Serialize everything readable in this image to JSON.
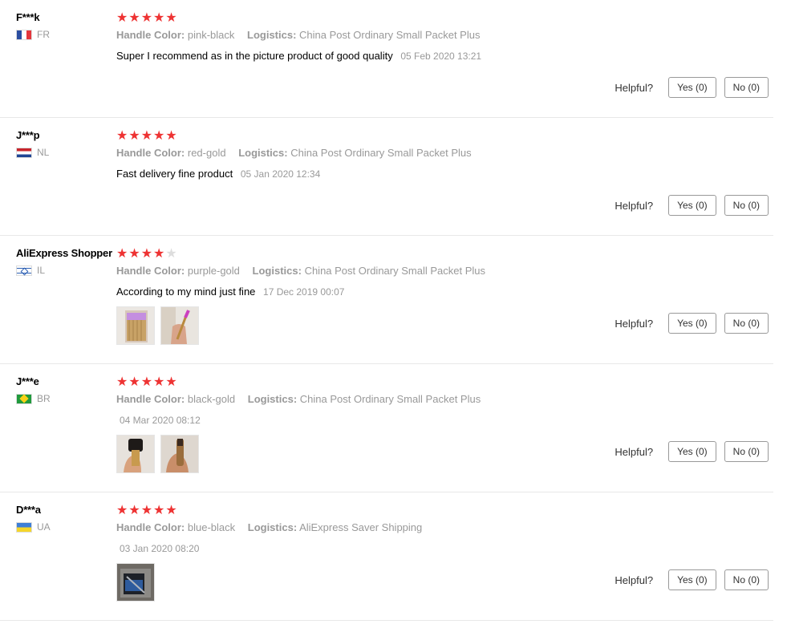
{
  "helpful_label": "Helpful?",
  "reviews": [
    {
      "user": "F***k",
      "country": "FR",
      "rating": 5,
      "handle_color_label": "Handle Color:",
      "handle_color": "pink-black",
      "logistics_label": "Logistics:",
      "logistics": "China Post Ordinary Small Packet Plus",
      "text": "Super I recommend as in the picture product of good quality",
      "date": "05 Feb 2020 13:21",
      "yes": "Yes (0)",
      "no": "No (0)"
    },
    {
      "user": "J***p",
      "country": "NL",
      "rating": 5,
      "handle_color_label": "Handle Color:",
      "handle_color": "red-gold",
      "logistics_label": "Logistics:",
      "logistics": "China Post Ordinary Small Packet Plus",
      "text": "Fast delivery fine product",
      "date": "05 Jan 2020 12:34",
      "yes": "Yes (0)",
      "no": "No (0)"
    },
    {
      "user": "AliExpress Shopper",
      "country": "IL",
      "rating": 4,
      "handle_color_label": "Handle Color:",
      "handle_color": "purple-gold",
      "logistics_label": "Logistics:",
      "logistics": "China Post Ordinary Small Packet Plus",
      "text": "According to my mind just fine",
      "date": "17 Dec 2019 00:07",
      "yes": "Yes (0)",
      "no": "No (0)",
      "photos": 2
    },
    {
      "user": "J***e",
      "country": "BR",
      "rating": 5,
      "handle_color_label": "Handle Color:",
      "handle_color": "black-gold",
      "logistics_label": "Logistics:",
      "logistics": "China Post Ordinary Small Packet Plus",
      "text": "",
      "date": "04 Mar 2020 08:12",
      "yes": "Yes (0)",
      "no": "No (0)",
      "photos": 2
    },
    {
      "user": "D***a",
      "country": "UA",
      "rating": 5,
      "handle_color_label": "Handle Color:",
      "handle_color": "blue-black",
      "logistics_label": "Logistics:",
      "logistics": "AliExpress Saver Shipping",
      "text": "",
      "date": "03 Jan 2020 08:20",
      "yes": "Yes (0)",
      "no": "No (0)",
      "photos": 1
    }
  ],
  "colors": {
    "star": "#ee3333",
    "star_off": "#dddddd",
    "muted": "#999999"
  }
}
